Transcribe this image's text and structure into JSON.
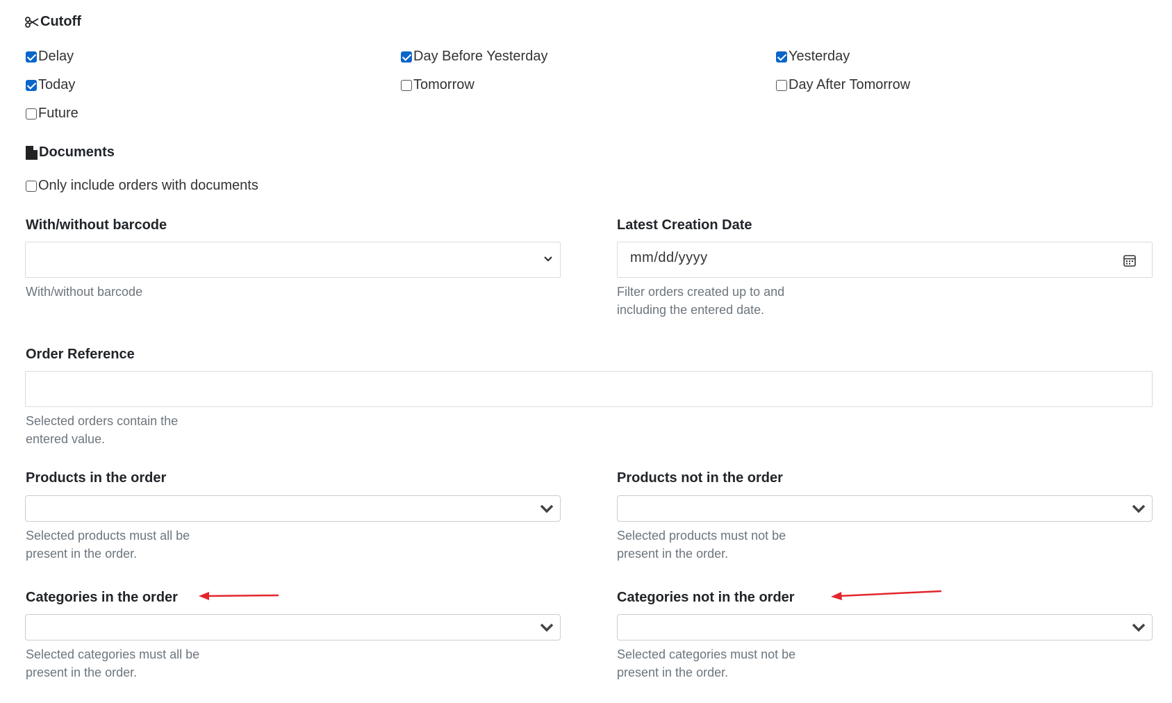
{
  "cutoff": {
    "title": "Cutoff",
    "icon": "scissors-icon",
    "options": [
      {
        "label": "Delay",
        "checked": true
      },
      {
        "label": "Day Before Yesterday",
        "checked": true
      },
      {
        "label": "Yesterday",
        "checked": true
      },
      {
        "label": "Today",
        "checked": true
      },
      {
        "label": "Tomorrow",
        "checked": false
      },
      {
        "label": "Day After Tomorrow",
        "checked": false
      },
      {
        "label": "Future",
        "checked": false
      }
    ]
  },
  "documents": {
    "title": "Documents",
    "icon": "file-icon",
    "option": {
      "label": "Only include orders with documents",
      "checked": false
    }
  },
  "barcode": {
    "label": "With/without barcode",
    "value": "",
    "help": "With/without barcode"
  },
  "creation_date": {
    "label": "Latest Creation Date",
    "placeholder": "mm/dd/yyyy",
    "help_line1": "Filter orders created up to and",
    "help_line2": "including the entered date."
  },
  "order_reference": {
    "label": "Order Reference",
    "value": "",
    "help_line1": "Selected orders contain the",
    "help_line2": "entered value."
  },
  "products_in": {
    "label": "Products in the order",
    "help_line1": "Selected products must all be",
    "help_line2": "present in the order."
  },
  "products_not_in": {
    "label": "Products not in the order",
    "help_line1": "Selected products must not be",
    "help_line2": "present in the order."
  },
  "categories_in": {
    "label": "Categories in the order",
    "help_line1": "Selected categories must all be",
    "help_line2": "present in the order."
  },
  "categories_not_in": {
    "label": "Categories not in the order",
    "help_line1": "Selected categories must not be",
    "help_line2": "present in the order."
  },
  "colors": {
    "checkbox_accent": "#0a66c9",
    "annotation_arrow": "#e3262c",
    "help_text": "#6c757d"
  }
}
